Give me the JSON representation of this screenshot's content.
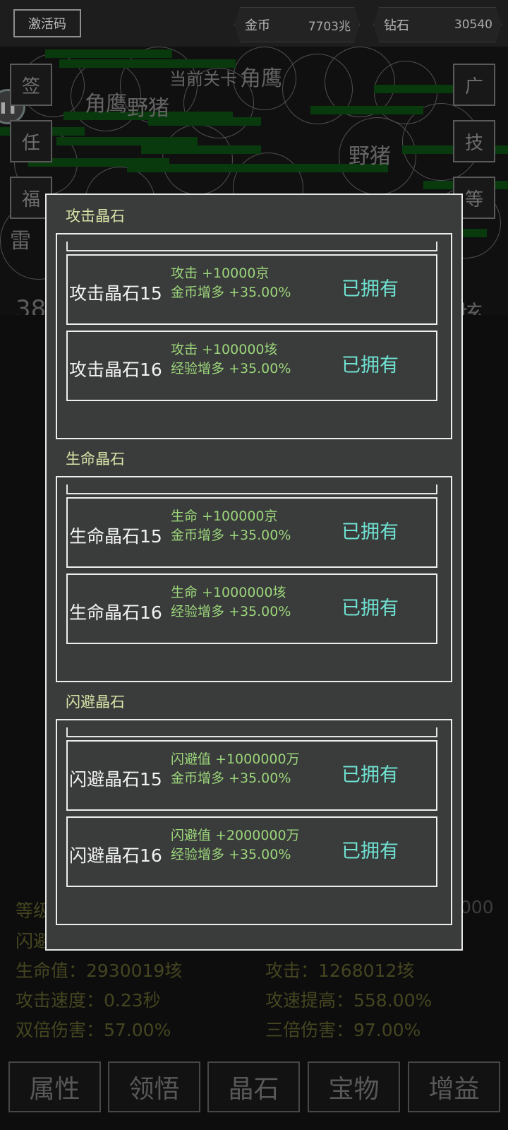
{
  "topbar": {
    "activation_label": "激活码",
    "gold_label": "金币",
    "gold_value": "7703兆",
    "diamond_label": "钻石",
    "diamond_value": "30540"
  },
  "side_left": [
    "签",
    "任",
    "福"
  ],
  "side_right": [
    "广",
    "技",
    "等"
  ],
  "battle": {
    "monster_texts": [
      "当前关卡",
      "野猪",
      "野猪",
      "角鹰",
      "角鹰",
      "雷"
    ],
    "left_number": "38",
    "right_text": "垓"
  },
  "stats": {
    "level_partial": "等级",
    "right_partial": "000",
    "dodge_partial": "闪避",
    "hp": "生命值：2930019垓",
    "attack": "攻击：1268012垓",
    "attack_speed": "攻击速度：0.23秒",
    "attack_speed_boost": "攻速提高：558.00%",
    "double_damage": "双倍伤害：57.00%",
    "triple_damage": "三倍伤害：97.00%"
  },
  "nav": [
    "属性",
    "领悟",
    "晶石",
    "宝物",
    "增益"
  ],
  "modal": {
    "sections": [
      {
        "title": "攻击晶石",
        "items": [
          {
            "name": "攻击晶石15",
            "attr1": "攻击 +10000京",
            "attr2": "金币增多 +35.00%",
            "status": "已拥有"
          },
          {
            "name": "攻击晶石16",
            "attr1": "攻击 +100000垓",
            "attr2": "经验增多 +35.00%",
            "status": "已拥有"
          }
        ]
      },
      {
        "title": "生命晶石",
        "items": [
          {
            "name": "生命晶石15",
            "attr1": "生命 +100000京",
            "attr2": "金币增多 +35.00%",
            "status": "已拥有"
          },
          {
            "name": "生命晶石16",
            "attr1": "生命 +1000000垓",
            "attr2": "经验增多 +35.00%",
            "status": "已拥有"
          }
        ]
      },
      {
        "title": "闪避晶石",
        "items": [
          {
            "name": "闪避晶石15",
            "attr1": "闪避值 +1000000万",
            "attr2": "金币增多 +35.00%",
            "status": "已拥有"
          },
          {
            "name": "闪避晶石16",
            "attr1": "闪避值 +2000000万",
            "attr2": "经验增多 +35.00%",
            "status": "已拥有"
          }
        ]
      }
    ]
  }
}
